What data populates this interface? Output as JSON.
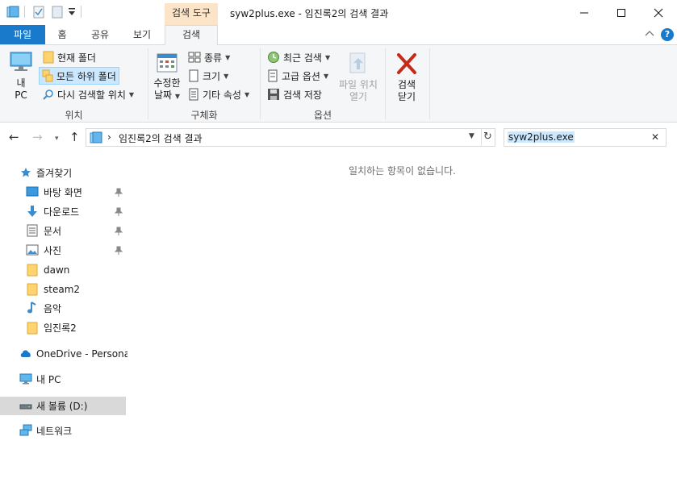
{
  "titlebar": {
    "context_tab_label": "검색 도구",
    "window_title": "syw2plus.exe - 임진록2의 검색 결과"
  },
  "tabs": {
    "file": "파일",
    "home": "홈",
    "share": "공유",
    "view": "보기",
    "search": "검색"
  },
  "ribbon": {
    "location": {
      "this_pc_line1": "내",
      "this_pc_line2": "PC",
      "current_folder": "현재 폴더",
      "all_subfolders": "모든 하위 폴더",
      "search_again": "다시 검색할 위치",
      "group_label": "위치"
    },
    "refine": {
      "date_modified_line1": "수정한",
      "date_modified_line2": "날짜",
      "kind": "종류",
      "size": "크기",
      "other_properties": "기타 속성",
      "group_label": "구체화"
    },
    "options": {
      "recent_searches": "최근 검색",
      "advanced_options": "고급 옵션",
      "save_search": "검색 저장",
      "open_file_location_line1": "파일 위치",
      "open_file_location_line2": "열기",
      "group_label": "옵션"
    },
    "close": {
      "label_line1": "검색",
      "label_line2": "닫기"
    }
  },
  "address": {
    "path": "임진록2의 검색 결과",
    "separator": "›"
  },
  "search": {
    "value": "syw2plus.exe"
  },
  "navpane": {
    "quick_access": "즐겨찾기",
    "items": [
      {
        "label": "바탕 화면",
        "pinned": true
      },
      {
        "label": "다운로드",
        "pinned": true
      },
      {
        "label": "문서",
        "pinned": true
      },
      {
        "label": "사진",
        "pinned": true
      },
      {
        "label": "dawn",
        "pinned": false
      },
      {
        "label": "steam2",
        "pinned": false
      },
      {
        "label": "음악",
        "pinned": false
      },
      {
        "label": "임진록2",
        "pinned": false
      }
    ],
    "onedrive": "OneDrive - Personal",
    "this_pc": "내 PC",
    "new_volume": "새 볼륨 (D:)",
    "network": "네트워크"
  },
  "content": {
    "empty_message": "일치하는 항목이 없습니다."
  },
  "colors": {
    "accent": "#1979ca",
    "context_tab": "#fbe4c8",
    "selection": "#cce8ff",
    "selected_nav": "#d9d9d9"
  }
}
